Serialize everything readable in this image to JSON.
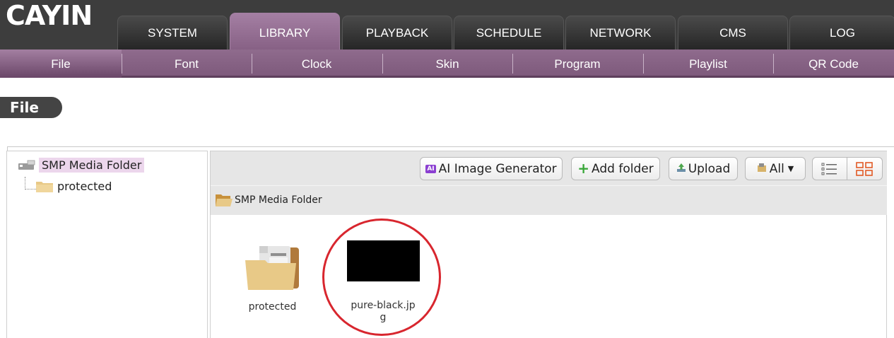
{
  "brand": {
    "logo_text": "CAYIN"
  },
  "main_tabs": [
    {
      "label": "SYSTEM"
    },
    {
      "label": "LIBRARY",
      "active": true
    },
    {
      "label": "PLAYBACK"
    },
    {
      "label": "SCHEDULE"
    },
    {
      "label": "NETWORK"
    },
    {
      "label": "CMS"
    },
    {
      "label": "LOG"
    }
  ],
  "sub_tabs": [
    {
      "label": "File",
      "active": true
    },
    {
      "label": "Font"
    },
    {
      "label": "Clock"
    },
    {
      "label": "Skin"
    },
    {
      "label": "Program"
    },
    {
      "label": "Playlist"
    },
    {
      "label": "QR Code"
    }
  ],
  "page": {
    "title": "File"
  },
  "tree": {
    "root_label": "SMP Media Folder",
    "children": [
      {
        "label": "protected"
      }
    ]
  },
  "toolbar": {
    "ai_badge": "AI",
    "ai_label": "AI Image Generator",
    "add_folder_label": "Add folder",
    "upload_label": "Upload",
    "filter_label": "All"
  },
  "path": {
    "current": "SMP Media Folder"
  },
  "items": [
    {
      "name": "protected",
      "kind": "folder"
    },
    {
      "name_line1": "pure-black.jp",
      "name_line2": "g",
      "kind": "image"
    }
  ],
  "colors": {
    "accent_purple": "#8f6b8d",
    "highlight_red": "#d8262e",
    "folder_tan": "#e8c987"
  }
}
